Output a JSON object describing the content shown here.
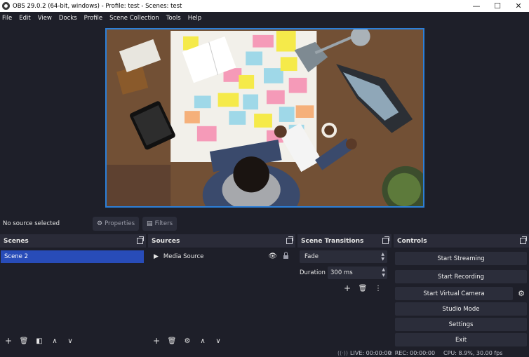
{
  "window": {
    "title": "OBS 29.0.2 (64-bit, windows) - Profile: test - Scenes: test",
    "controls": {
      "minimize": "—",
      "maximize": "☐",
      "close": "✕"
    }
  },
  "menu": [
    "File",
    "Edit",
    "View",
    "Docks",
    "Profile",
    "Scene Collection",
    "Tools",
    "Help"
  ],
  "context": {
    "no_source": "No source selected",
    "properties_label": "Properties",
    "filters_label": "Filters"
  },
  "scenes": {
    "title": "Scenes",
    "items": [
      "Scene 2"
    ]
  },
  "sources": {
    "title": "Sources",
    "items": [
      {
        "name": "Media Source"
      }
    ]
  },
  "transitions": {
    "title": "Scene Transitions",
    "selected": "Fade",
    "duration_label": "Duration",
    "duration_value": "300 ms"
  },
  "controls": {
    "title": "Controls",
    "buttons": [
      "Start Streaming",
      "Start Recording",
      "Start Virtual Camera",
      "Studio Mode",
      "Settings",
      "Exit"
    ]
  },
  "status": {
    "live": "LIVE: 00:00:00",
    "rec": "REC: 00:00:00",
    "cpu": "CPU: 8.9%, 30.00 fps"
  },
  "colors": {
    "accent": "#284cb8",
    "preview_border": "#2c7fd8",
    "background": "#1e1f29",
    "dock": "#2a2b38"
  }
}
